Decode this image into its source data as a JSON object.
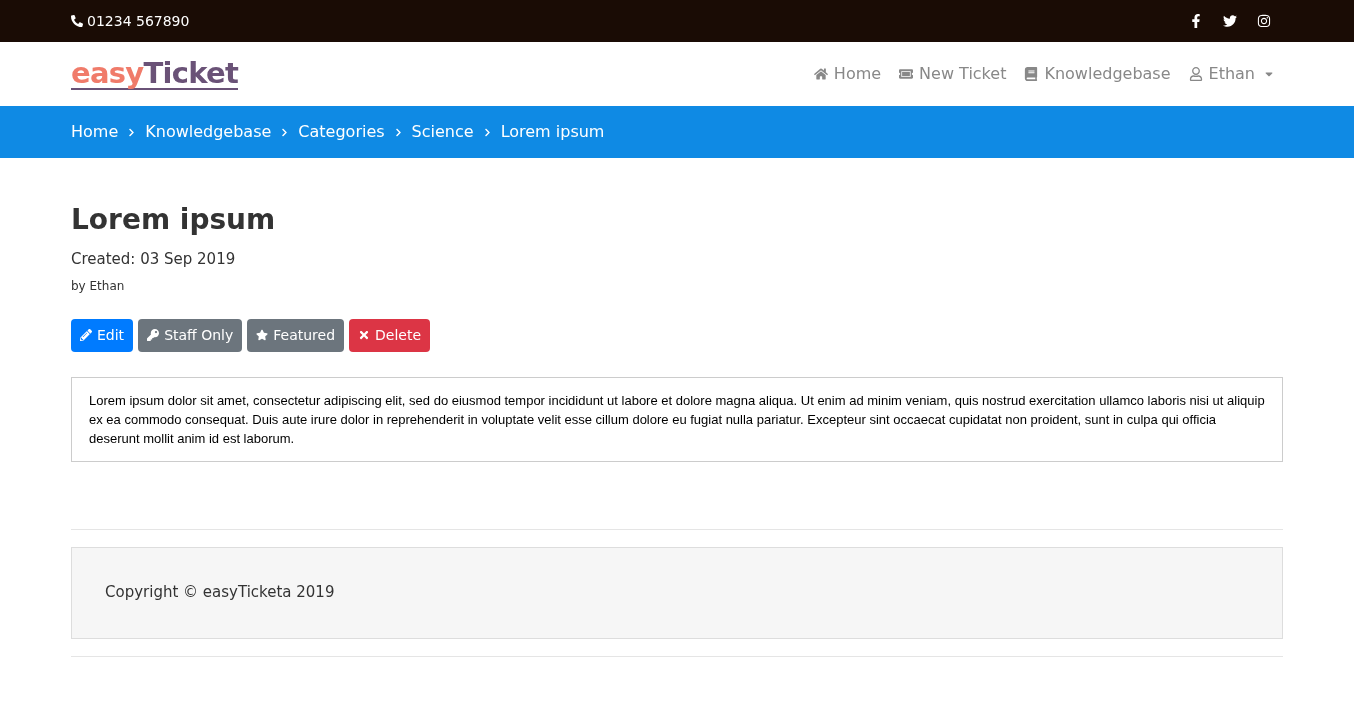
{
  "topbar": {
    "phone": "01234 567890"
  },
  "logo": {
    "parts": [
      {
        "text": "easy",
        "color": "#f07b6a"
      },
      {
        "text": "Ticket",
        "color": "#6a5277"
      }
    ]
  },
  "nav": [
    {
      "kind": "home",
      "label": "Home"
    },
    {
      "kind": "ticket",
      "label": "New Ticket"
    },
    {
      "kind": "book",
      "label": "Knowledgebase"
    },
    {
      "kind": "user",
      "label": "Ethan",
      "dropdown": true
    }
  ],
  "breadcrumb": [
    "Home",
    "Knowledgebase",
    "Categories",
    "Science",
    "Lorem ipsum"
  ],
  "article": {
    "title": "Lorem ipsum",
    "created": "Created: 03 Sep 2019",
    "author": "by Ethan",
    "buttons": [
      {
        "kind": "edit",
        "label": "Edit"
      },
      {
        "kind": "staff",
        "label": "Staff Only"
      },
      {
        "kind": "featured",
        "label": "Featured"
      },
      {
        "kind": "delete",
        "label": "Delete"
      }
    ],
    "body": "Lorem ipsum dolor sit amet, consectetur adipiscing elit, sed do eiusmod tempor incididunt ut labore et dolore magna aliqua. Ut enim ad minim veniam, quis nostrud exercitation ullamco laboris nisi ut aliquip ex ea commodo consequat. Duis aute irure dolor in reprehenderit in voluptate velit esse cillum dolore eu fugiat nulla pariatur. Excepteur sint occaecat cupidatat non proident, sunt in culpa qui officia deserunt mollit anim id est laborum."
  },
  "footer": {
    "copyright": "Copyright © easyTicketa 2019"
  }
}
